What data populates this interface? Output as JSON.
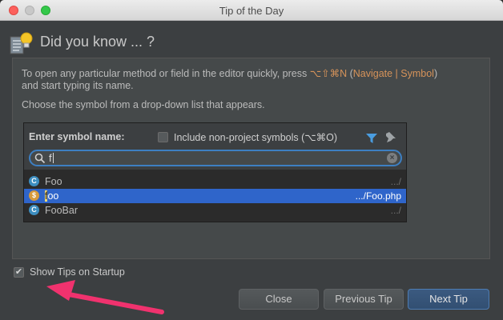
{
  "window": {
    "title": "Tip of the Day"
  },
  "header": {
    "title": "Did you know ... ?",
    "icon": "lightbulb-icon"
  },
  "tip": {
    "line1_prefix": "To open any particular method or field in the editor quickly, press ",
    "shortcut": "⌥⇧⌘N",
    "line1_middle": " (",
    "nav_link": "Navigate | Symbol",
    "line1_suffix": ")",
    "line2": "and start typing its name.",
    "line3": "Choose the symbol from a drop-down list that appears."
  },
  "popup": {
    "enter_label": "Enter symbol name:",
    "include_label": "Include non-project symbols (⌥⌘O)",
    "include_checked": false,
    "search_value": "f",
    "results": [
      {
        "kind": "C",
        "name_hl": "",
        "name_rest": "Foo",
        "path": ".../",
        "selected": false
      },
      {
        "kind": "$",
        "name_hl": "f",
        "name_rest": "oo",
        "path": ".../Foo.php",
        "selected": true
      },
      {
        "kind": "C",
        "name_hl": "",
        "name_rest": "FooBar",
        "path": ".../",
        "selected": false
      }
    ]
  },
  "footer": {
    "show_tips_label": "Show Tips on Startup",
    "show_tips_checked": true,
    "check_mark": "✔",
    "close_label": "Close",
    "prev_label": "Previous Tip",
    "next_label": "Next Tip"
  },
  "colors": {
    "accent": "#2f65ca",
    "highlight": "#d6935a",
    "annotation_arrow": "#f0326e"
  }
}
